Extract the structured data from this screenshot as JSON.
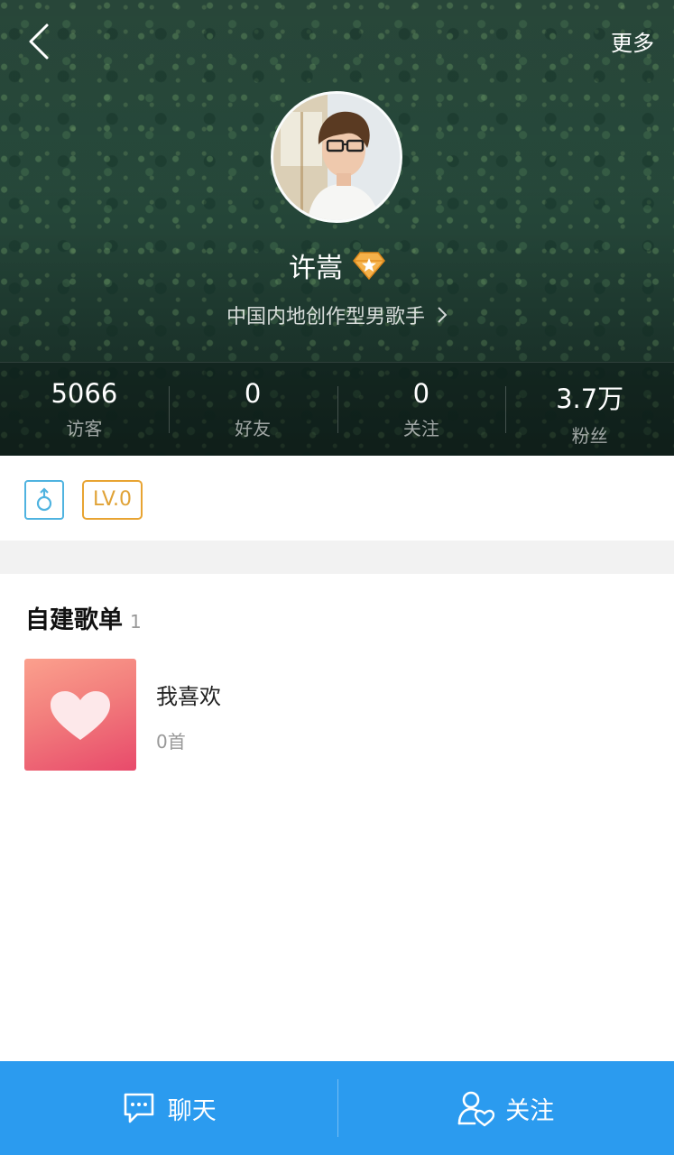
{
  "header": {
    "more_label": "更多",
    "name": "许嵩",
    "description": "中国内地创作型男歌手"
  },
  "stats": [
    {
      "value": "5066",
      "label": "访客"
    },
    {
      "value": "0",
      "label": "好友"
    },
    {
      "value": "0",
      "label": "关注"
    },
    {
      "value": "3.7万",
      "label": "粉丝"
    }
  ],
  "tags": {
    "gender_icon": "male-symbol-icon",
    "level": "LV.0"
  },
  "playlists": {
    "section_title": "自建歌单",
    "section_count": "1",
    "items": [
      {
        "title": "我喜欢",
        "count": "0首",
        "cover_icon": "heart-icon"
      }
    ]
  },
  "bottom_bar": {
    "chat_label": "聊天",
    "follow_label": "关注"
  },
  "colors": {
    "accent_blue": "#2b9bef",
    "level_gold": "#e8a432",
    "gender_blue": "#4fb3e0"
  }
}
